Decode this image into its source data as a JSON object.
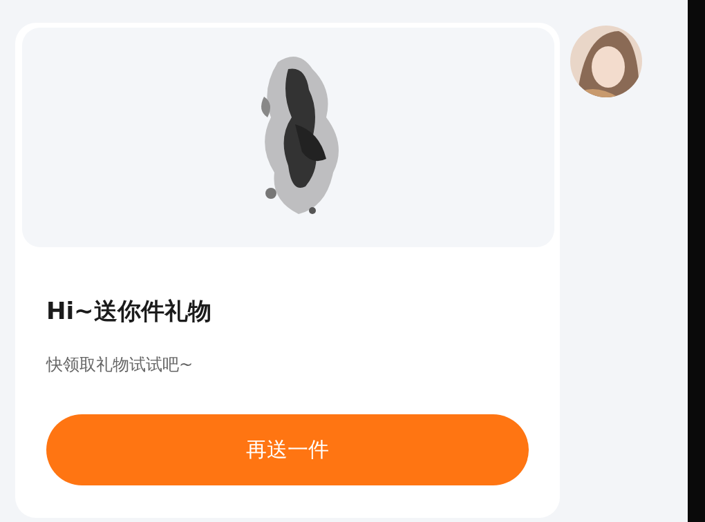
{
  "message": {
    "title": "Hi~送你件礼物",
    "subtitle": "快领取礼物试试吧~",
    "button": "再送一件"
  }
}
